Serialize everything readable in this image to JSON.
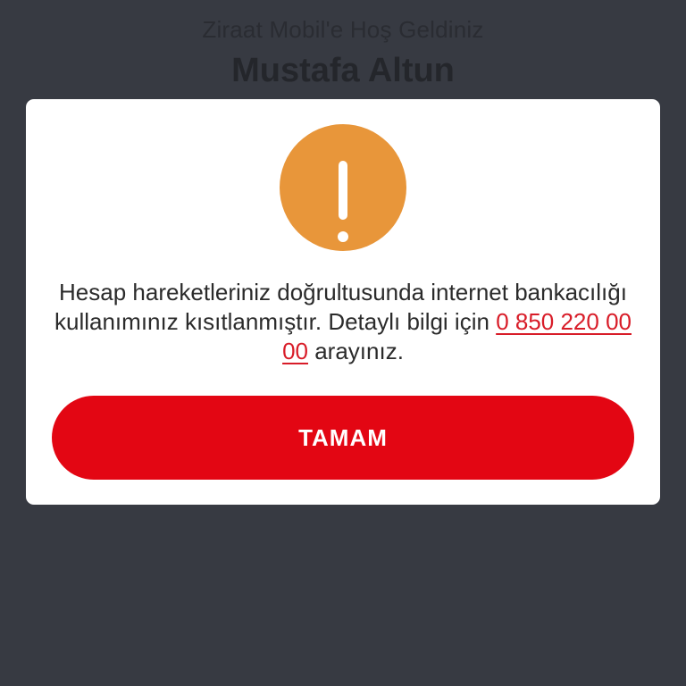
{
  "background": {
    "welcome_text": "Ziraat Mobil'e Hoş Geldiniz",
    "user_name": "Mustafa Altun"
  },
  "dialog": {
    "icon": "exclamation-icon",
    "icon_color": "#e8963a",
    "message_part1": "Hesap hareketleriniz doğrultusunda internet bankacılığı kullanımınız kısıtlanmıştır. Detaylı bilgi için",
    "phone_number": "0 850 220 00 00",
    "message_part2": "arayınız.",
    "button_label": "TAMAM",
    "button_color": "#e30613"
  }
}
